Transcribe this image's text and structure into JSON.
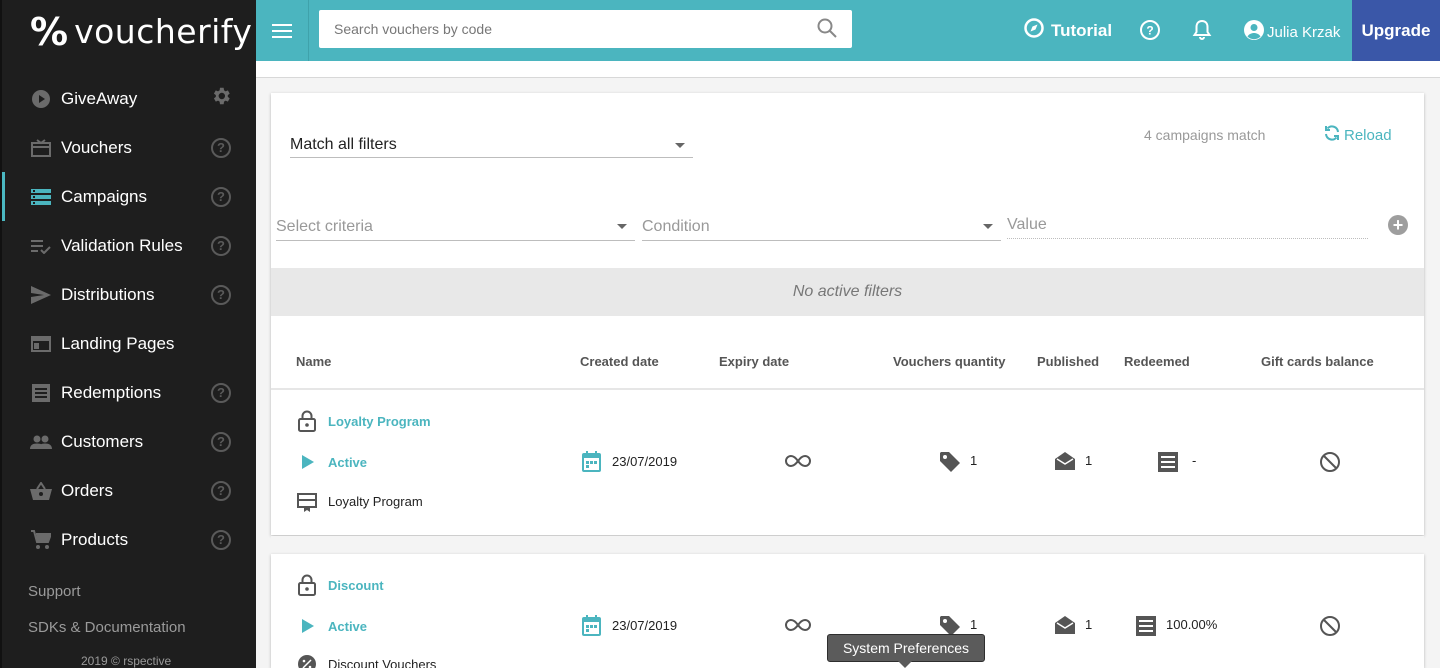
{
  "brand": {
    "logo_text": "voucherify",
    "accent": "#4bb5bf",
    "upgrade_color": "#3a57a8"
  },
  "sidebar": {
    "items": [
      {
        "label": "GiveAway",
        "icon": "play-circle-icon",
        "trailing": "gear-icon"
      },
      {
        "label": "Vouchers",
        "icon": "gift-card-icon",
        "trailing": "help-icon"
      },
      {
        "label": "Campaigns",
        "icon": "list-icon",
        "trailing": "help-icon",
        "active": true
      },
      {
        "label": "Validation Rules",
        "icon": "checklist-icon",
        "trailing": "help-icon"
      },
      {
        "label": "Distributions",
        "icon": "send-icon",
        "trailing": "help-icon"
      },
      {
        "label": "Landing Pages",
        "icon": "browser-icon",
        "trailing": "none"
      },
      {
        "label": "Redemptions",
        "icon": "receipt-icon",
        "trailing": "help-icon"
      },
      {
        "label": "Customers",
        "icon": "people-icon",
        "trailing": "help-icon"
      },
      {
        "label": "Orders",
        "icon": "basket-icon",
        "trailing": "help-icon"
      },
      {
        "label": "Products",
        "icon": "cart-icon",
        "trailing": "help-icon"
      }
    ],
    "support": "Support",
    "sdks": "SDKs & Documentation",
    "copyright": "2019 © rspective"
  },
  "topbar": {
    "search_placeholder": "Search vouchers by code",
    "tutorial": "Tutorial",
    "user": "Julia Krzak",
    "upgrade": "Upgrade"
  },
  "filters": {
    "match": "Match all filters",
    "count": "4 campaigns match",
    "reload": "Reload",
    "criteria_placeholder": "Select criteria",
    "condition_placeholder": "Condition",
    "value_placeholder": "Value",
    "no_filters": "No active filters"
  },
  "table": {
    "headers": [
      "Name",
      "Created date",
      "Expiry date",
      "Vouchers quantity",
      "Published",
      "Redeemed",
      "Gift cards balance"
    ],
    "rows": [
      {
        "name": "Loyalty Program",
        "status": "Active",
        "type": "Loyalty Program",
        "type_icon": "loyalty-card-icon",
        "created": "23/07/2019",
        "quantity": "1",
        "published": "1",
        "redeemed": "-"
      },
      {
        "name": "Discount",
        "status": "Active",
        "type": "Discount Vouchers",
        "type_icon": "discount-icon",
        "created": "23/07/2019",
        "quantity": "1",
        "published": "1",
        "redeemed": "100.00%"
      }
    ]
  },
  "tooltip": "System Preferences"
}
